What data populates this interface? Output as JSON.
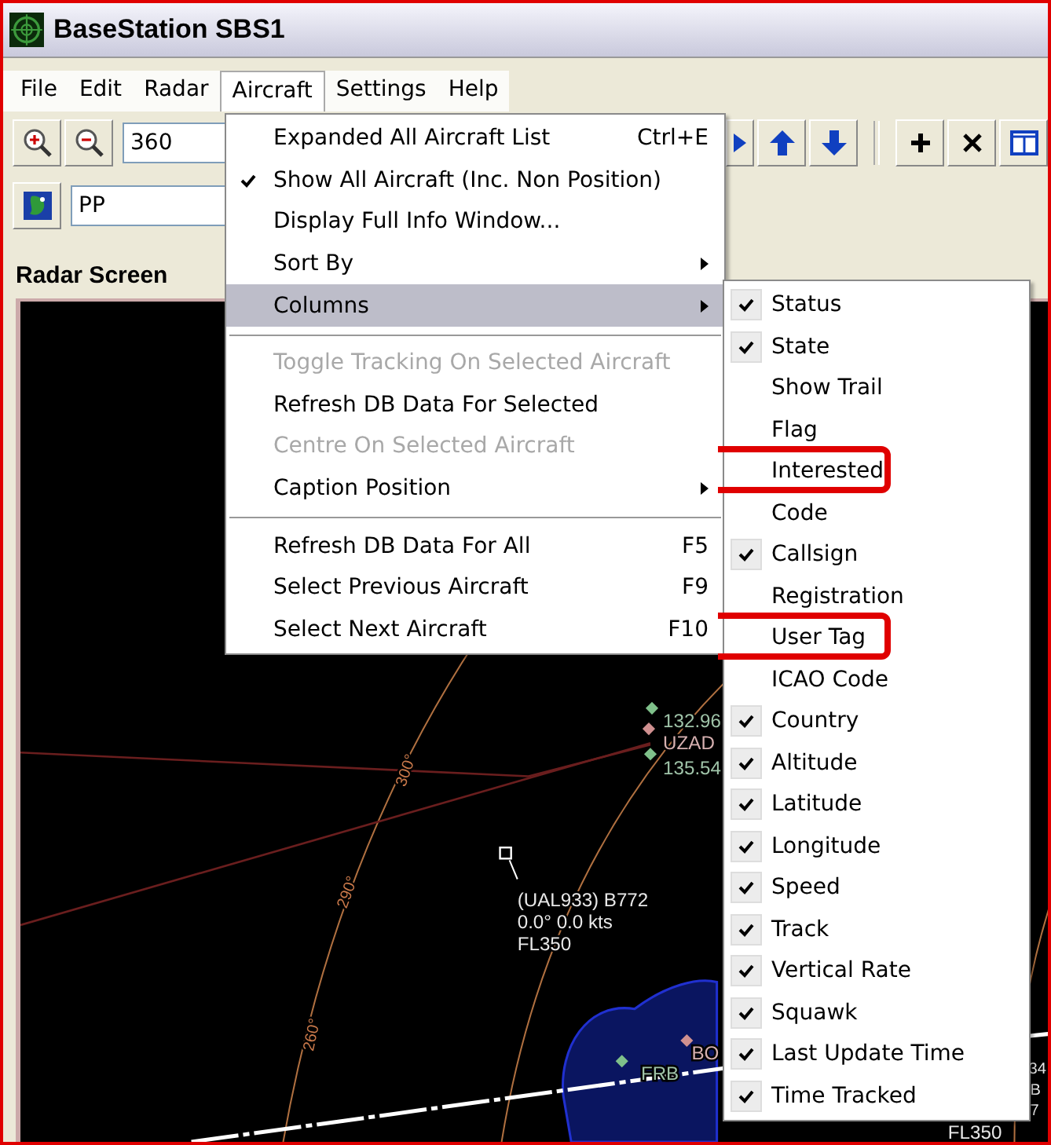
{
  "window": {
    "title": "BaseStation SBS1"
  },
  "menubar": [
    {
      "label": "File",
      "selected": false
    },
    {
      "label": "Edit",
      "selected": false
    },
    {
      "label": "Radar",
      "selected": false
    },
    {
      "label": "Aircraft",
      "selected": true
    },
    {
      "label": "Settings",
      "selected": false
    },
    {
      "label": "Help",
      "selected": false
    }
  ],
  "toolbar": {
    "range_field": {
      "value": "360"
    },
    "filter_field": {
      "value": "PP"
    }
  },
  "panel_title": "Radar Screen",
  "aircraft_menu": [
    {
      "kind": "item",
      "label": "Expanded All Aircraft List",
      "shortcut": "Ctrl+E",
      "checked": false,
      "disabled": false,
      "submenu": false,
      "selected": false
    },
    {
      "kind": "item",
      "label": "Show All Aircraft (Inc. Non Position)",
      "checked": true,
      "disabled": false,
      "submenu": false,
      "selected": false
    },
    {
      "kind": "item",
      "label": "Display Full Info Window...",
      "checked": false,
      "disabled": false,
      "submenu": false,
      "selected": false
    },
    {
      "kind": "item",
      "label": "Sort By",
      "checked": false,
      "disabled": false,
      "submenu": true,
      "selected": false
    },
    {
      "kind": "item",
      "label": "Columns",
      "checked": false,
      "disabled": false,
      "submenu": true,
      "selected": true
    },
    {
      "kind": "separator"
    },
    {
      "kind": "item",
      "label": "Toggle Tracking On Selected Aircraft",
      "checked": false,
      "disabled": true,
      "submenu": false,
      "selected": false
    },
    {
      "kind": "item",
      "label": "Refresh DB Data For Selected",
      "checked": false,
      "disabled": false,
      "submenu": false,
      "selected": false
    },
    {
      "kind": "item",
      "label": "Centre On Selected Aircraft",
      "checked": false,
      "disabled": true,
      "submenu": false,
      "selected": false
    },
    {
      "kind": "item",
      "label": "Caption Position",
      "checked": false,
      "disabled": false,
      "submenu": true,
      "selected": false
    },
    {
      "kind": "separator"
    },
    {
      "kind": "item",
      "label": "Refresh DB Data For All",
      "shortcut": "F5",
      "checked": false,
      "disabled": false,
      "submenu": false,
      "selected": false
    },
    {
      "kind": "item",
      "label": "Select Previous Aircraft",
      "shortcut": "F9",
      "checked": false,
      "disabled": false,
      "submenu": false,
      "selected": false
    },
    {
      "kind": "item",
      "label": "Select Next Aircraft",
      "shortcut": "F10",
      "checked": false,
      "disabled": false,
      "submenu": false,
      "selected": false
    }
  ],
  "columns_menu": [
    {
      "label": "Status",
      "checked": true,
      "highlighted": false
    },
    {
      "label": "State",
      "checked": true,
      "highlighted": false
    },
    {
      "label": "Show Trail",
      "checked": false,
      "highlighted": false
    },
    {
      "label": "Flag",
      "checked": false,
      "highlighted": false
    },
    {
      "label": "Interested",
      "checked": false,
      "highlighted": true
    },
    {
      "label": "Code",
      "checked": false,
      "highlighted": false
    },
    {
      "label": "Callsign",
      "checked": true,
      "highlighted": false
    },
    {
      "label": "Registration",
      "checked": false,
      "highlighted": false
    },
    {
      "label": "User Tag",
      "checked": false,
      "highlighted": true
    },
    {
      "label": "ICAO Code",
      "checked": false,
      "highlighted": false
    },
    {
      "label": "Country",
      "checked": true,
      "highlighted": false
    },
    {
      "label": "Altitude",
      "checked": true,
      "highlighted": false
    },
    {
      "label": "Latitude",
      "checked": true,
      "highlighted": false
    },
    {
      "label": "Longitude",
      "checked": true,
      "highlighted": false
    },
    {
      "label": "Speed",
      "checked": true,
      "highlighted": false
    },
    {
      "label": "Track",
      "checked": true,
      "highlighted": false
    },
    {
      "label": "Vertical Rate",
      "checked": true,
      "highlighted": false
    },
    {
      "label": "Squawk",
      "checked": true,
      "highlighted": false
    },
    {
      "label": "Last Update Time",
      "checked": true,
      "highlighted": false
    },
    {
      "label": "Time Tracked",
      "checked": true,
      "highlighted": false
    }
  ],
  "radar_labels": [
    {
      "kind": "angle",
      "text": "300°"
    },
    {
      "kind": "angle",
      "text": "290°"
    },
    {
      "kind": "angle",
      "text": "260°"
    },
    {
      "kind": "frequency",
      "text": "132.96"
    },
    {
      "kind": "waypoint",
      "text": "UZAD"
    },
    {
      "kind": "frequency",
      "text": "135.54"
    },
    {
      "kind": "aircraft",
      "text": "(UAL933) B772"
    },
    {
      "kind": "aircraft",
      "text": "0.0° 0.0 kts"
    },
    {
      "kind": "aircraft",
      "text": "FL350"
    },
    {
      "kind": "waypoint",
      "text": "BO"
    },
    {
      "kind": "frequency",
      "text": "FRB"
    },
    {
      "kind": "aircraft",
      "text": "34"
    },
    {
      "kind": "aircraft",
      "text": "B"
    },
    {
      "kind": "aircraft",
      "text": "7"
    },
    {
      "kind": "aircraft",
      "text": "FL350"
    }
  ]
}
